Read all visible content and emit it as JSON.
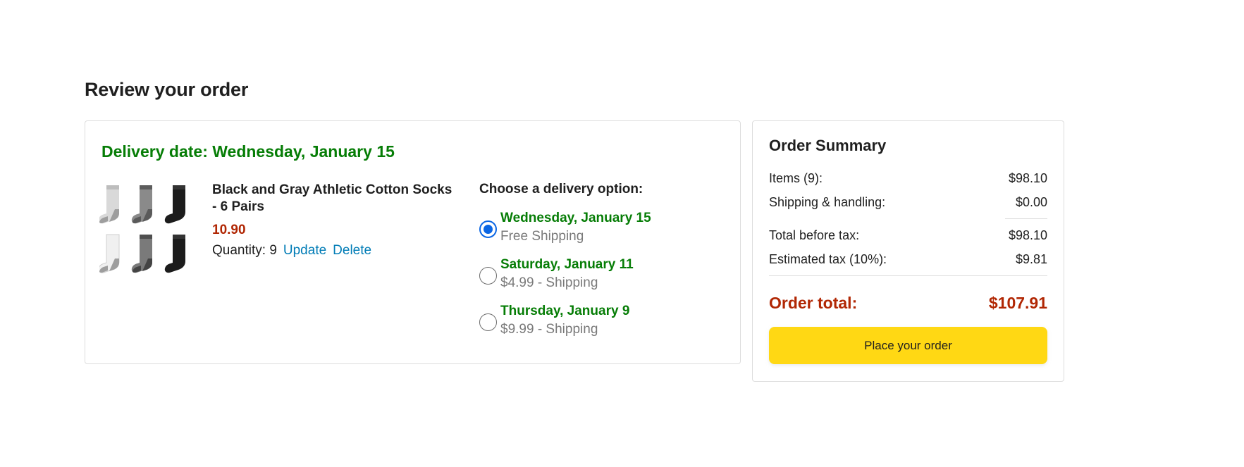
{
  "page": {
    "title": "Review your order"
  },
  "order": {
    "delivery_date": "Delivery date: Wednesday, January 15",
    "product": {
      "name": "Black and Gray Athletic Cotton Socks - 6 Pairs",
      "price": "10.90",
      "quantity_label": "Quantity: 9",
      "update_label": "Update",
      "delete_label": "Delete",
      "image_icon": "socks-product-image"
    },
    "delivery_options": {
      "heading": "Choose a delivery option:",
      "options": [
        {
          "date": "Wednesday, January 15",
          "price": "Free Shipping",
          "selected": true
        },
        {
          "date": "Saturday, January 11",
          "price": "$4.99 - Shipping",
          "selected": false
        },
        {
          "date": "Thursday, January 9",
          "price": "$9.99 - Shipping",
          "selected": false
        }
      ]
    }
  },
  "summary": {
    "title": "Order Summary",
    "items_label": "Items (9):",
    "items_value": "$98.10",
    "shipping_label": "Shipping & handling:",
    "shipping_value": "$0.00",
    "before_tax_label": "Total before tax:",
    "before_tax_value": "$98.10",
    "tax_label": "Estimated tax (10%):",
    "tax_value": "$9.81",
    "total_label": "Order total:",
    "total_value": "$107.91",
    "place_order_label": "Place your order"
  },
  "colors": {
    "green": "#067d06",
    "price_red": "#b12704",
    "link_blue": "#017cb6",
    "button_yellow": "#ffd814",
    "radio_blue": "#0a66e4"
  }
}
